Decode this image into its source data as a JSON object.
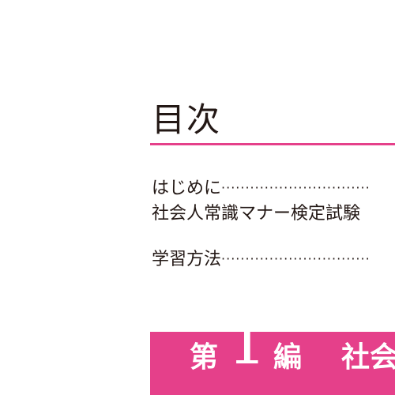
{
  "toc": {
    "title": "目次",
    "entries": [
      {
        "label": "はじめに",
        "leader": "·······························"
      },
      {
        "label": "社会人常識マナー検定試験"
      },
      {
        "label": "学習方法",
        "leader": "·······························"
      }
    ]
  },
  "part": {
    "prefix": "第",
    "number": "1",
    "suffix": "編",
    "title": "社会"
  },
  "colors": {
    "accent": "#e5408a",
    "text": "#231815",
    "background": "#ffffff"
  }
}
